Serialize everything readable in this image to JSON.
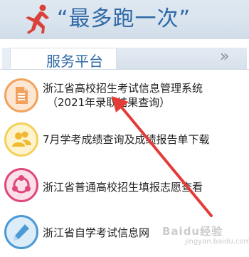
{
  "header": {
    "title": "“最多跑一次”"
  },
  "tabs": {
    "active_label": "服务平台",
    "more_glyph": "»"
  },
  "services": [
    {
      "line1": "浙江省高校招生考试信息管理系统",
      "line2": "（2021年录取结果查询）",
      "icon": "document-icon",
      "color": "#f2a25c"
    },
    {
      "line1": "7月学考成绩查询及成绩报告单下载",
      "icon": "users-icon",
      "color": "#f4d15a"
    },
    {
      "line1": "浙江省普通高校招生填报志愿查看",
      "icon": "network-icon",
      "color": "#e0477a"
    },
    {
      "line1": "浙江省自学考试信息网",
      "icon": "pencil-icon",
      "color": "#4a9ad6"
    }
  ],
  "annotation": {
    "arrow_color": "#e53b36"
  },
  "watermark": {
    "brand": "Baidu经验",
    "sub": "jingyan.baidu.com"
  }
}
